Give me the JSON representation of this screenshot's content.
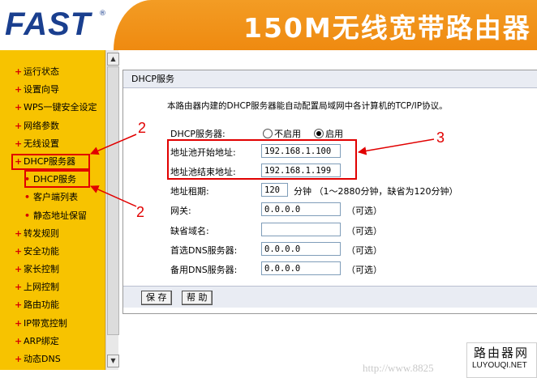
{
  "header": {
    "logo": "FAST",
    "logo_mark": "®",
    "product": "150M无线宽带路由器"
  },
  "sidebar": {
    "items": [
      {
        "label": "运行状态",
        "sub": false
      },
      {
        "label": "设置向导",
        "sub": false
      },
      {
        "label": "WPS一键安全设定",
        "sub": false
      },
      {
        "label": "网络参数",
        "sub": false
      },
      {
        "label": "无线设置",
        "sub": false
      },
      {
        "label": "DHCP服务器",
        "sub": false
      },
      {
        "label": "DHCP服务",
        "sub": true
      },
      {
        "label": "客户端列表",
        "sub": true
      },
      {
        "label": "静态地址保留",
        "sub": true
      },
      {
        "label": "转发规则",
        "sub": false
      },
      {
        "label": "安全功能",
        "sub": false
      },
      {
        "label": "家长控制",
        "sub": false
      },
      {
        "label": "上网控制",
        "sub": false
      },
      {
        "label": "路由功能",
        "sub": false
      },
      {
        "label": "IP带宽控制",
        "sub": false
      },
      {
        "label": "ARP绑定",
        "sub": false
      },
      {
        "label": "动态DNS",
        "sub": false
      }
    ]
  },
  "panel": {
    "title": "DHCP服务",
    "description": "本路由器内建的DHCP服务器能自动配置局域网中各计算机的TCP/IP协议。",
    "dhcp_server_label": "DHCP服务器:",
    "disable_label": "不启用",
    "enable_label": "启用",
    "selected": "启用",
    "start_label": "地址池开始地址:",
    "start_value": "192.168.1.100",
    "end_label": "地址池结束地址:",
    "end_value": "192.168.1.199",
    "lease_label": "地址租期:",
    "lease_value": "120",
    "lease_hint": "分钟  （1～2880分钟，缺省为120分钟）",
    "gateway_label": "网关:",
    "gateway_value": "0.0.0.0",
    "domain_label": "缺省域名:",
    "domain_value": "",
    "dns1_label": "首选DNS服务器:",
    "dns1_value": "0.0.0.0",
    "dns2_label": "备用DNS服务器:",
    "dns2_value": "0.0.0.0",
    "optional": "（可选）",
    "save_button": "保 存",
    "help_button": "帮 助"
  },
  "annotations": {
    "num_top": "2",
    "num_bottom": "2",
    "num_right": "3",
    "color": "#e10000"
  },
  "watermark": {
    "line1": "路由器网",
    "line2": "LUYOUQI.NET",
    "url": "http://www.8825"
  }
}
